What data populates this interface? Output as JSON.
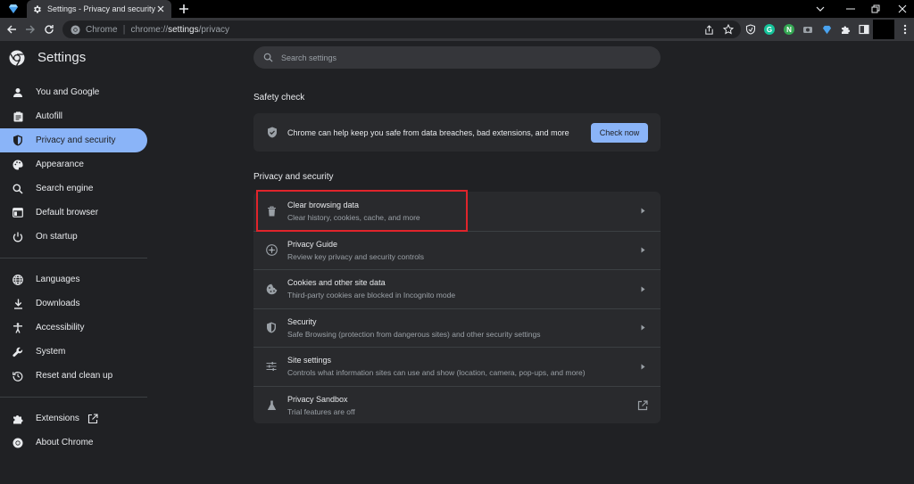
{
  "browser": {
    "tab_title": "Settings - Privacy and security",
    "omnibox_chip": "Chrome",
    "url_prefix": "chrome://",
    "url_path": "settings",
    "url_suffix": "/privacy"
  },
  "settings": {
    "title": "Settings",
    "search_placeholder": "Search settings"
  },
  "sidebar": {
    "items": [
      {
        "label": "You and Google",
        "icon": "person-icon"
      },
      {
        "label": "Autofill",
        "icon": "clipboard-icon"
      },
      {
        "label": "Privacy and security",
        "icon": "shield-icon",
        "active": true
      },
      {
        "label": "Appearance",
        "icon": "palette-icon"
      },
      {
        "label": "Search engine",
        "icon": "search-icon"
      },
      {
        "label": "Default browser",
        "icon": "browser-window-icon"
      },
      {
        "label": "On startup",
        "icon": "power-icon"
      },
      {
        "label": "Languages",
        "icon": "globe-icon"
      },
      {
        "label": "Downloads",
        "icon": "download-icon"
      },
      {
        "label": "Accessibility",
        "icon": "accessibility-icon"
      },
      {
        "label": "System",
        "icon": "wrench-icon"
      },
      {
        "label": "Reset and clean up",
        "icon": "history-icon"
      },
      {
        "label": "Extensions",
        "icon": "puzzle-icon"
      },
      {
        "label": "About Chrome",
        "icon": "chrome-icon"
      }
    ]
  },
  "safety_check": {
    "heading": "Safety check",
    "text": "Chrome can help keep you safe from data breaches, bad extensions, and more",
    "button": "Check now"
  },
  "privacy": {
    "heading": "Privacy and security",
    "rows": [
      {
        "title": "Clear browsing data",
        "subtitle": "Clear history, cookies, cache, and more",
        "icon": "trash-icon"
      },
      {
        "title": "Privacy Guide",
        "subtitle": "Review key privacy and security controls",
        "icon": "compass-icon"
      },
      {
        "title": "Cookies and other site data",
        "subtitle": "Third-party cookies are blocked in Incognito mode",
        "icon": "cookie-icon"
      },
      {
        "title": "Security",
        "subtitle": "Safe Browsing (protection from dangerous sites) and other security settings",
        "icon": "shield-icon"
      },
      {
        "title": "Site settings",
        "subtitle": "Controls what information sites can use and show (location, camera, pop-ups, and more)",
        "icon": "sliders-icon"
      },
      {
        "title": "Privacy Sandbox",
        "subtitle": "Trial features are off",
        "icon": "flask-icon"
      }
    ]
  },
  "colors": {
    "accent": "#8ab4f8",
    "background": "#202124",
    "card": "#292a2d",
    "highlight_box": "#e0242b"
  }
}
